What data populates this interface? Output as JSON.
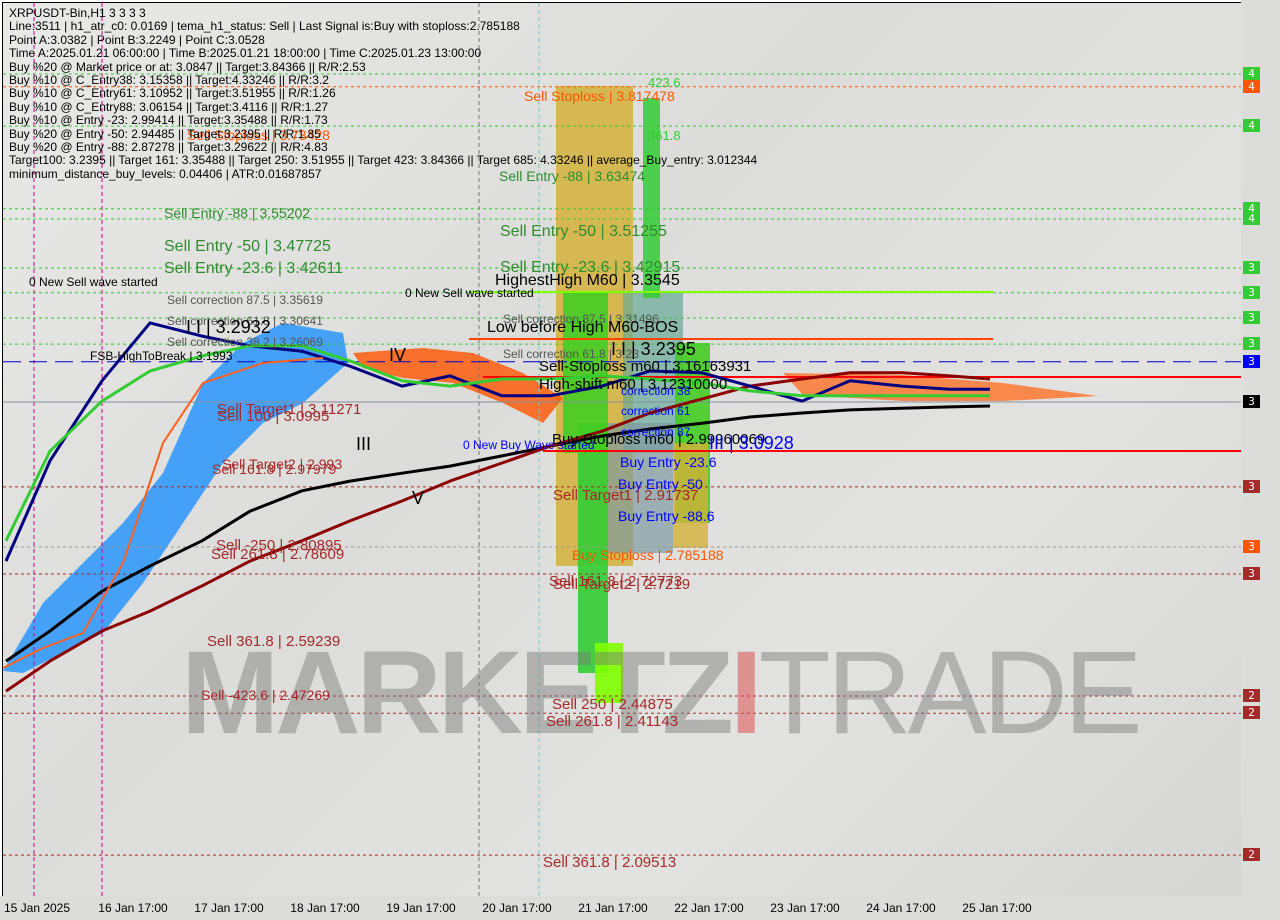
{
  "header": {
    "title": "XRPUSDT-Bin,H1  3 3 3 3",
    "info_lines": [
      "Line:3511 | h1_atr_c0: 0.0169 | tema_h1_status: Sell | Last Signal is:Buy with stoploss:2.785188",
      "Point A:3.0382 | Point B:3.2249 | Point C:3.0528",
      "Time A:2025.01.21 06:00:00 | Time B:2025.01.21 18:00:00 | Time C:2025.01.23 13:00:00",
      "Buy %20 @ Market price or at: 3.0847 || Target:3.84366 || R/R:2.53",
      "Buy %10 @ C_Entry38: 3.15358 || Target:4.33246 || R/R:3.2",
      "Buy %10 @ C_Entry61: 3.10952 || Target:3.51955 || R/R:1.26",
      "Buy %10 @ C_Entry88: 3.06154 || Target:3.4116 || R/R:1.27",
      "Buy %10 @ Entry -23: 2.99414 || Target:3.35488 || R/R:1.73",
      "Buy %20 @ Entry -50: 2.94485 || Target:3.2395 || R/R:1.85",
      "Buy %20 @ Entry -88: 2.87278 || Target:3.29622 || R/R:4.83",
      "Target100: 3.2395 || Target 161: 3.35488 || Target 250: 3.51955 || Target 423: 3.84366 || Target 685: 4.33246 || average_Buy_entry: 3.012344",
      "minimum_distance_buy_levels: 0.04406 | ATR:0.01687857"
    ]
  },
  "watermark": {
    "part1": "MARKETZ",
    "part2": "I",
    "part3": "TRADE"
  },
  "colors": {
    "green": "#33cc33",
    "orange": "#ff5500",
    "brown": "#a52a2a",
    "blue": "#0000ff",
    "navy": "#000080",
    "black": "#000000",
    "red": "#ff0000",
    "lime": "#7fff00",
    "gold": "#d4b13a",
    "cyan_cloud": "#1e90ff"
  },
  "x_axis": {
    "ticks": [
      "15 Jan 2025",
      "16 Jan 17:00",
      "17 Jan 17:00",
      "18 Jan 17:00",
      "19 Jan 17:00",
      "20 Jan 17:00",
      "21 Jan 17:00",
      "22 Jan 17:00",
      "23 Jan 17:00",
      "24 Jan 17:00",
      "25 Jan 17:00"
    ]
  },
  "price_levels": [
    {
      "price": 3.862,
      "color": "#33cc33",
      "style": "dash",
      "badge": "4"
    },
    {
      "price": 3.833,
      "color": "#ff5500",
      "style": "dash",
      "badge": "4"
    },
    {
      "price": 3.744,
      "color": "#33cc33",
      "style": "dash",
      "badge": "4"
    },
    {
      "price": 3.557,
      "color": "#33cc33",
      "style": "dash",
      "badge": "4"
    },
    {
      "price": 3.534,
      "color": "#33cc33",
      "style": "dash",
      "badge": "4"
    },
    {
      "price": 3.423,
      "color": "#33cc33",
      "style": "dash",
      "badge": "3"
    },
    {
      "price": 3.367,
      "color": "#33cc33",
      "style": "dash",
      "badge": "3"
    },
    {
      "price": 3.31,
      "color": "#33cc33",
      "style": "dash",
      "badge": "3"
    },
    {
      "price": 3.251,
      "color": "#33cc33",
      "style": "dash",
      "badge": "3"
    },
    {
      "price": 3.211,
      "color": "#0000cc",
      "style": "longdash",
      "badge": "3"
    },
    {
      "price": 3.12,
      "color": "#8090a0",
      "style": "solid",
      "badge": "3",
      "badge_color": "#000000"
    },
    {
      "price": 2.928,
      "color": "#a52a2a",
      "style": "dash",
      "badge": "3"
    },
    {
      "price": 2.792,
      "color": "#999999",
      "style": "dash",
      "badge": "3",
      "badge_color": "#ff5500"
    },
    {
      "price": 2.731,
      "color": "#a52a2a",
      "style": "dash",
      "badge": "3"
    },
    {
      "price": 2.455,
      "color": "#a52a2a",
      "style": "dash",
      "badge": "2"
    },
    {
      "price": 2.416,
      "color": "#a52a2a",
      "style": "dash",
      "badge": "2"
    },
    {
      "price": 2.095,
      "color": "#a52a2a",
      "style": "dash",
      "badge": "2"
    }
  ],
  "annotations": [
    "423.6",
    "Sell Stoploss | 3.817478",
    "361.8",
    "Sell Entry -88 | 3.63474",
    "Sell Entry -88 | 3.55202",
    "Sell Entry -50 | 3.51255",
    "Sell Entry -50 | 3.47725",
    "Sell Entry -23.6 | 3.42611",
    "Sell Entry -23.6 | 3.42915",
    "HighestHigh   M60 | 3.3545",
    "0 New Sell wave started",
    "0 New Sell wave started",
    "Sell correction 87.5 | 3.35619",
    "Sell correction 87.5 | 3.31496",
    "Low before High   M60-BOS",
    "Sell correction 61.8 | 3.30641",
    "Sell correction 38.2 | 3.26069",
    "Sell correction 61.8 | 3.23",
    "I I | 3.2932",
    "I I | 3.2395",
    "FSB-HighToBreak | 3.1993",
    "IV",
    "Sell-Stoploss m60 | 3.16163931",
    "High-shift m60 | 3.12310000",
    "correction 38",
    "correction 61",
    "correction 87",
    "Sell Target1 | 3.11271",
    "Sell 100 | 3.0995",
    "III",
    "0 New Buy Wave started",
    "Buy-Stoploss m60 | 2.99960069",
    "III | 3.0928",
    "Sell Target2 | 2.993",
    "Sell 161.8 | 2.97979",
    "Buy Entry -23.6",
    "Buy Entry -50",
    "Sell Target1 | 2.91737",
    "V",
    "Buy Entry -88.6",
    "Sell -250 | 2.80895",
    "Sell 261.8 | 2.78609",
    "Buy Stoploss | 2.785188",
    "Sell 161.8 | 2.72773",
    "Sell Target2 | 2.7219",
    "Sell 361.8 | 2.59239",
    "Sell -423.6 | 2.47269",
    "Sell 250 | 2.44875",
    "Sell 261.8 | 2.41143",
    "Sell 361.8 | 2.09513",
    "Sell Stoploss | 3.73428"
  ],
  "chart_data": {
    "type": "line",
    "title": "XRPUSDT-Bin,H1",
    "ylim": [
      2.0,
      3.95
    ],
    "x": [
      "2025-01-15 09:00",
      "2025-01-15 20:00",
      "2025-01-16 09:00",
      "2025-01-16 21:00",
      "2025-01-17 10:00",
      "2025-01-17 22:00",
      "2025-01-18 11:00",
      "2025-01-18 23:00",
      "2025-01-19 12:00",
      "2025-01-20 00:00",
      "2025-01-20 13:00",
      "2025-01-21 01:00",
      "2025-01-21 14:00",
      "2025-01-22 02:00",
      "2025-01-22 15:00",
      "2025-01-23 03:00",
      "2025-01-23 16:00",
      "2025-01-24 04:00",
      "2025-01-24 17:00",
      "2025-01-25 05:00",
      "2025-01-25 15:00"
    ],
    "series": [
      {
        "color": "#000000",
        "values": [
          2.534,
          2.602,
          2.692,
          2.749,
          2.806,
          2.873,
          2.919,
          2.941,
          2.959,
          2.975,
          2.998,
          3.02,
          3.043,
          3.059,
          3.072,
          3.086,
          3.095,
          3.102,
          3.106,
          3.109,
          3.111
        ]
      },
      {
        "color": "#8b0000",
        "values": [
          2.466,
          2.534,
          2.602,
          2.647,
          2.704,
          2.76,
          2.806,
          2.851,
          2.896,
          2.941,
          2.982,
          3.02,
          3.054,
          3.095,
          3.127,
          3.156,
          3.172,
          3.186,
          3.186,
          3.179,
          3.172
        ]
      },
      {
        "color": "#000080",
        "values": [
          2.76,
          2.987,
          3.168,
          3.299,
          3.269,
          3.247,
          3.235,
          3.201,
          3.156,
          3.179,
          3.134,
          3.134,
          3.156,
          3.19,
          3.186,
          3.156,
          3.122,
          3.168,
          3.156,
          3.149,
          3.149
        ]
      },
      {
        "color": "#33cc33",
        "values": [
          2.806,
          3.009,
          3.122,
          3.19,
          3.224,
          3.247,
          3.247,
          3.213,
          3.168,
          3.156,
          3.172,
          3.172,
          3.179,
          3.172,
          3.163,
          3.145,
          3.134,
          3.134,
          3.134,
          3.134,
          3.134
        ]
      }
    ],
    "grid": false
  }
}
